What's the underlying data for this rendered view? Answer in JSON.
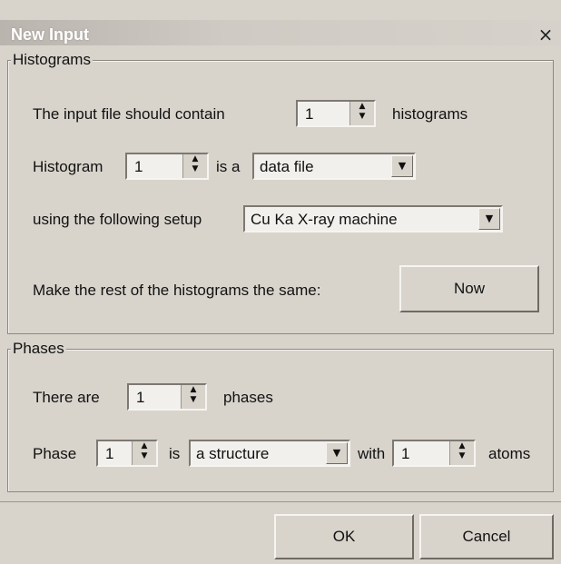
{
  "window": {
    "title": "New Input",
    "close_glyph": "×"
  },
  "histograms": {
    "group_label": "Histograms",
    "contain_prefix": "The input file should contain",
    "count": "1",
    "contain_suffix": "histograms",
    "histogram_prefix": "Histogram",
    "histogram_index": "1",
    "is_a": "is a",
    "type_selected": "data file",
    "setup_label": "using the following setup",
    "setup_selected": "Cu Ka X-ray machine",
    "same_label": "Make the rest of the histograms the same:",
    "now_button": "Now"
  },
  "phases": {
    "group_label": "Phases",
    "there_are": "There are",
    "count": "1",
    "phases_suffix": "phases",
    "phase_prefix": "Phase",
    "phase_index": "1",
    "is_label": "is",
    "type_selected": "a structure",
    "with_label": "with",
    "atoms_count": "1",
    "atoms_suffix": "atoms"
  },
  "footer": {
    "ok": "OK",
    "cancel": "Cancel"
  },
  "icons": {
    "up": "▲",
    "down": "▼",
    "dropdown": "▼"
  }
}
